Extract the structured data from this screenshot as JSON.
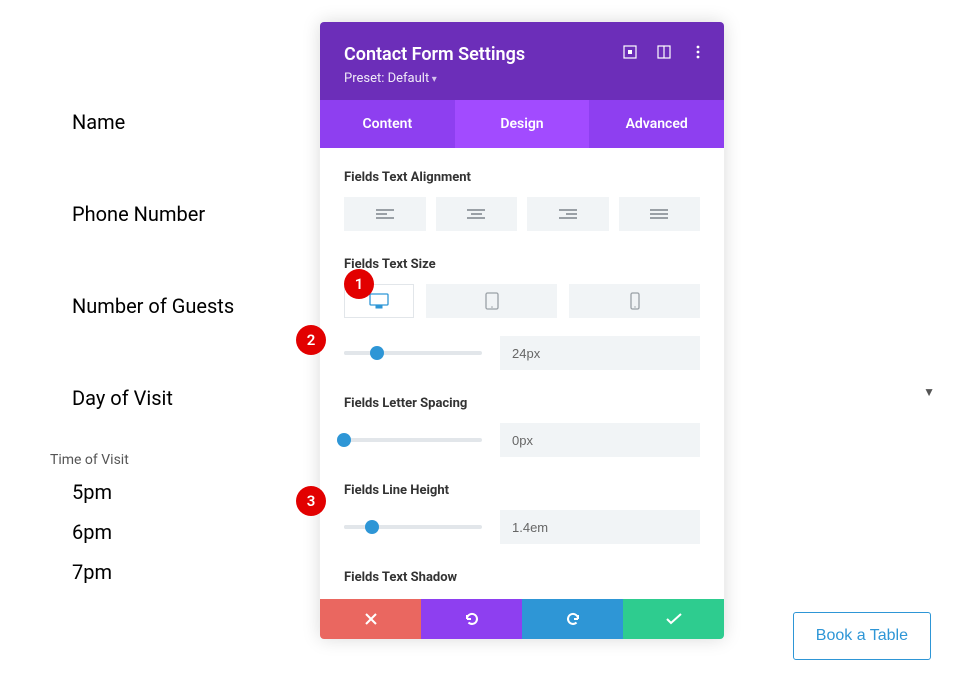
{
  "form": {
    "fields": [
      "Name",
      "Phone Number",
      "Number of Guests",
      "Day of Visit"
    ],
    "group_label": "Time of Visit",
    "times": [
      "5pm",
      "6pm",
      "7pm"
    ]
  },
  "panel": {
    "title": "Contact Form Settings",
    "preset": "Preset: Default",
    "tabs": {
      "content": "Content",
      "design": "Design",
      "advanced": "Advanced"
    },
    "header_icons": {
      "responsive": "responsive-icon",
      "columns": "columns-icon",
      "more": "more-icon"
    },
    "sections": {
      "alignment_label": "Fields Text Alignment",
      "text_size_label": "Fields Text Size",
      "text_size_value": "24px",
      "letter_spacing_label": "Fields Letter Spacing",
      "letter_spacing_value": "0px",
      "line_height_label": "Fields Line Height",
      "line_height_value": "1.4em",
      "text_shadow_label": "Fields Text Shadow"
    },
    "footer": {
      "cancel": "cancel",
      "undo": "undo",
      "redo": "redo",
      "save": "save"
    }
  },
  "annotations": {
    "dot1": "1",
    "dot2": "2",
    "dot3": "3"
  },
  "cta": {
    "book": "Book a Table"
  }
}
